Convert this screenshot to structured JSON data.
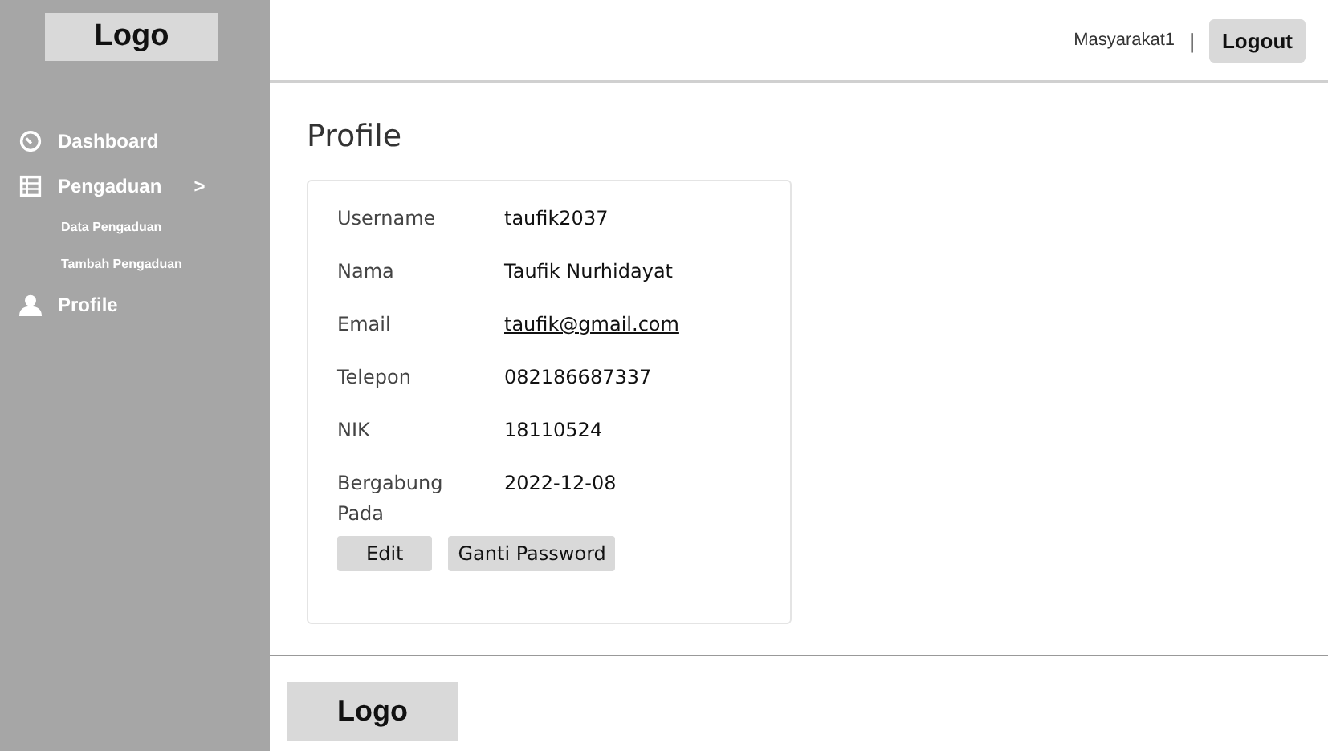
{
  "sidebar": {
    "logo": "Logo",
    "items": [
      {
        "label": "Dashboard",
        "kind": "gauge"
      },
      {
        "label": "Pengaduan",
        "kind": "list",
        "expander": ">",
        "children": [
          {
            "label": "Data Pengaduan"
          },
          {
            "label": "Tambah Pengaduan"
          }
        ]
      },
      {
        "label": "Profile",
        "kind": "person"
      }
    ]
  },
  "topbar": {
    "user": "Masyarakat1",
    "separator": "|",
    "logout": "Logout"
  },
  "page_title": "Profile",
  "profile": {
    "fields": [
      {
        "label": "Username",
        "value": "taufik2037",
        "kind": "text"
      },
      {
        "label": "Nama",
        "value": "Taufik Nurhidayat",
        "kind": "text"
      },
      {
        "label": "Email",
        "value": "taufik@gmail.com",
        "kind": "link"
      },
      {
        "label": "Telepon",
        "value": "082186687337",
        "kind": "text"
      },
      {
        "label": "NIK",
        "value": "18110524",
        "kind": "text"
      },
      {
        "label": "Bergabung Pada",
        "value": "2022-12-08",
        "kind": "text"
      }
    ],
    "buttons": [
      "Edit",
      "Ganti Password"
    ]
  },
  "footer": {
    "logo": "Logo"
  }
}
